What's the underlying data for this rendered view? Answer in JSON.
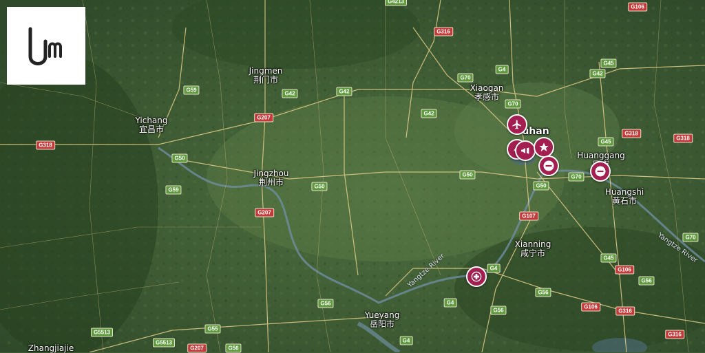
{
  "map": {
    "cities": [
      {
        "id": "jingmen",
        "name": "Jingmen",
        "name_cn": "荆门市"
      },
      {
        "id": "yichang",
        "name": "Yichang",
        "name_cn": "宜昌市"
      },
      {
        "id": "jingzhou",
        "name": "Jingzhou",
        "name_cn": "荆州市"
      },
      {
        "id": "xiaogan",
        "name": "Xiaogan",
        "name_cn": "孝感市"
      },
      {
        "id": "wuhan",
        "name": "uhan",
        "name_cn": ""
      },
      {
        "id": "huanggang",
        "name": "Huanggang",
        "name_cn": "冈市"
      },
      {
        "id": "huangshi",
        "name": "Huangshi",
        "name_cn": "黄石市"
      },
      {
        "id": "xianning",
        "name": "Xianning",
        "name_cn": "咸宁市"
      },
      {
        "id": "yueyang",
        "name": "Yueyang",
        "name_cn": "岳阳市"
      },
      {
        "id": "zhangjiajie",
        "name": "Zhangjiajie",
        "name_cn": ""
      }
    ],
    "road_labels": [
      "G106",
      "G4213",
      "G316",
      "G4",
      "G45",
      "G70",
      "G42",
      "G59",
      "G207",
      "G318",
      "G50",
      "G55",
      "G5513",
      "G56",
      "G107",
      "G4",
      "G316",
      "G106",
      "G56",
      "G45",
      "G70"
    ],
    "river_label": "Yangtze River",
    "markers": [
      {
        "id": "airport",
        "icon": "airplane-icon"
      },
      {
        "id": "megaphone",
        "icon": "megaphone-icon"
      },
      {
        "id": "star",
        "icon": "star-icon"
      },
      {
        "id": "no-entry-1",
        "icon": "no-entry-icon"
      },
      {
        "id": "no-entry-2",
        "icon": "no-entry-icon"
      },
      {
        "id": "medical",
        "icon": "medical-cross-icon"
      }
    ],
    "colors": {
      "marker": "#a31f4f",
      "road_shield": "#5f9a3f",
      "red_shield": "#c23a3a",
      "terrain": "#3d5a33"
    }
  },
  "logo": {
    "icon": "um-logo-icon"
  }
}
